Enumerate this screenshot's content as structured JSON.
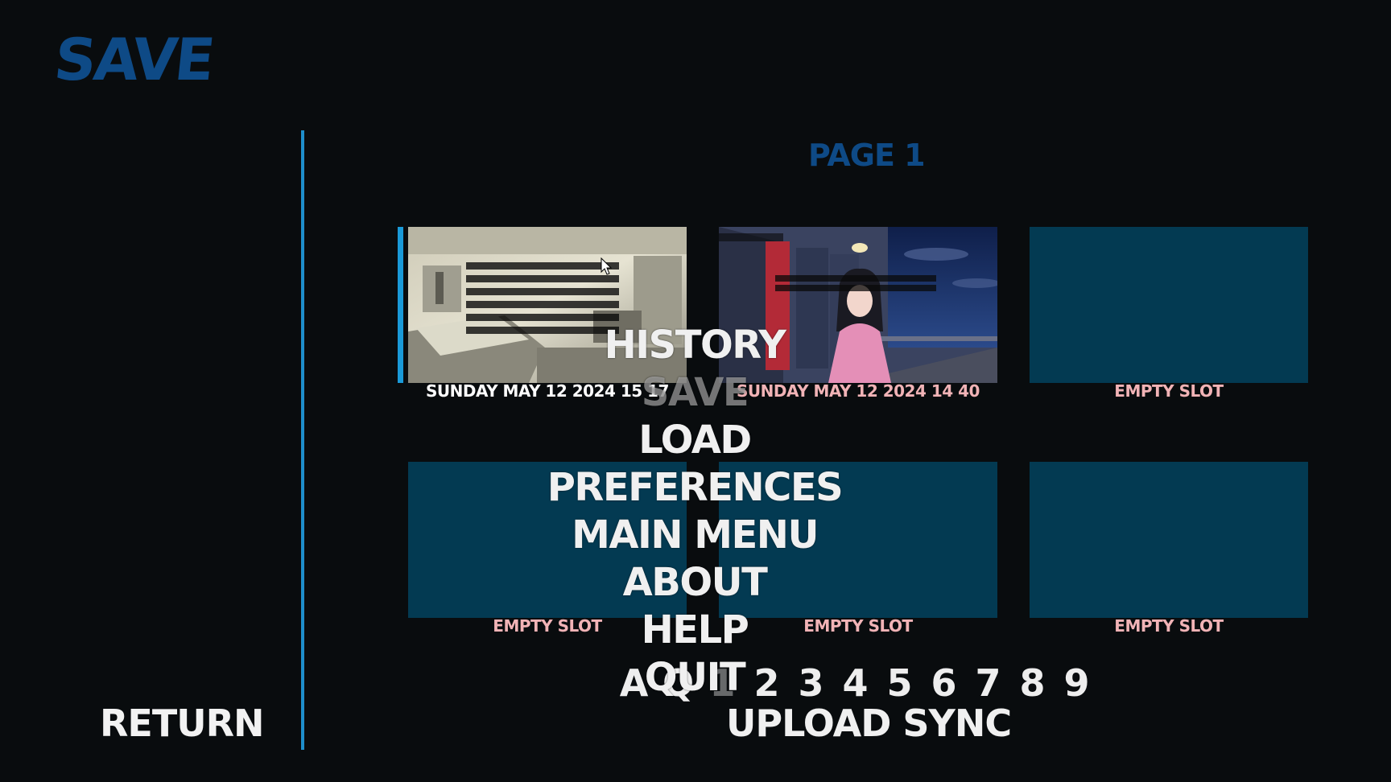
{
  "screen": {
    "title": "SAVE",
    "return_label": "RETURN",
    "page_title": "PAGE 1",
    "sync_label": "UPLOAD SYNC"
  },
  "slots": [
    {
      "label": "SUNDAY  MAY 12 2024  15 17",
      "thumbnail": "bedroom-scene",
      "selected": true
    },
    {
      "label": "SUNDAY  MAY 12 2024  14 40",
      "thumbnail": "hallway-scene",
      "selected": false
    },
    {
      "label": "EMPTY SLOT",
      "thumbnail": "",
      "selected": false
    },
    {
      "label": "EMPTY SLOT",
      "thumbnail": "",
      "selected": false
    },
    {
      "label": "EMPTY SLOT",
      "thumbnail": "",
      "selected": false
    },
    {
      "label": "EMPTY SLOT",
      "thumbnail": "",
      "selected": false
    }
  ],
  "nav_menu": {
    "history": "HISTORY",
    "save": "SAVE",
    "load": "LOAD",
    "preferences": "PREFERENCES",
    "main_menu": "MAIN MENU",
    "about": "ABOUT",
    "help": "HELP",
    "quit": "QUIT"
  },
  "pager": [
    "A",
    "Q",
    "1",
    "2",
    "3",
    "4",
    "5",
    "6",
    "7",
    "8",
    "9"
  ],
  "pager_current": "1",
  "colors": {
    "background": "#090c0e",
    "title_blue": "#0e4a86",
    "accent_blue": "#1e8fcc",
    "slot_teal": "#033a52",
    "slot_label_pink": "#f1b3b6",
    "menu_text": "#f0f0f0"
  }
}
